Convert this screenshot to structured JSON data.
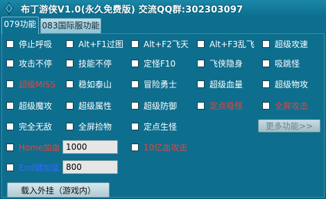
{
  "window": {
    "title": "布丁游侠V1.0(永久免费版)  交流QQ群:302303097"
  },
  "tabs": [
    {
      "label": "079功能",
      "active": true
    },
    {
      "label": "083国际服功能",
      "active": false
    }
  ],
  "checkboxes": {
    "r1": [
      "停止呼吸",
      "Alt+F1过图",
      "Alt+F2飞天",
      "Alt+F3乱飞",
      "超级攻速"
    ],
    "r2": [
      "攻击不停",
      "技能不停",
      "定怪F10",
      "飞侠隐身",
      "吸跳怪"
    ],
    "r3": [
      "超级MISS",
      "稳如泰山",
      "冒险勇士",
      "超级血量",
      "超级物攻"
    ],
    "r4": [
      "超级魔攻",
      "超级属性",
      "超级防御",
      "定点吸怪",
      "全屏攻击"
    ],
    "r5": [
      "完全无敌",
      "全屏捡物",
      "定点生怪"
    ],
    "home": "Home加血",
    "end": "End键加蓝",
    "billion": "10亿血攻击"
  },
  "inputs": {
    "home_value": "1000",
    "end_value": "800"
  },
  "buttons": {
    "more": "更多功能>>",
    "load": "载入外挂（游戏内）"
  },
  "colors": {
    "background": "#0e6f8e",
    "red_label": "#e8443a",
    "blue_label": "#2f6cff"
  }
}
